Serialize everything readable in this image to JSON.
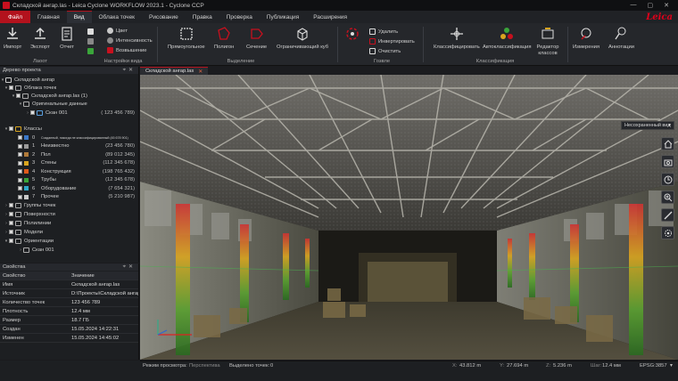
{
  "window": {
    "title": "Складской ангар.las - Leica Cyclone WORKFLOW 2023.1 - Cyclone CCP",
    "controls": [
      "—",
      "▢",
      "✕"
    ]
  },
  "menu": {
    "items": [
      "Файл",
      "Главная",
      "Вид",
      "Облака точек",
      "Рисование",
      "Правка",
      "Проверка",
      "Публикация",
      "Расширения"
    ],
    "active": "Вид"
  },
  "brand": "Leica",
  "ribbon": {
    "import": "Импорт",
    "export": "Экспорт",
    "report": "Отчет",
    "color": "Цвет",
    "intensity": "Интенсивность",
    "elevation": "Возвышение",
    "group_file": "Лаоот",
    "group_view": "Настройки вида",
    "rect": "Прямоугольное",
    "polygon": "Полигон",
    "section": "Сечение",
    "bbox": "Ограничивающий куб",
    "group_select": "Выделение",
    "delete": "Удалить",
    "invert": "Инвертировать",
    "clear": "Очистить",
    "group_fence": "Гозвле",
    "classify": "Классифицировать",
    "autoclass": "Автоклассификация",
    "classeditor": "Редактор классов",
    "group_class": "Классификация",
    "measure": "Измерения",
    "annotations": "Аннотации"
  },
  "project": {
    "header": "Дерево проекта",
    "root": "Складской ангар",
    "clouds": "Облака точек",
    "cloud_file": "Складской ангар.las (1)",
    "original": "Оригинальные данные",
    "scan": "Скан 001",
    "scan_count": "( 123 456 789)",
    "classes_label": "Классы",
    "classes": [
      {
        "num": "0",
        "name": "Созданный, никогда не классифицированный (45 678 901)",
        "count": "",
        "color": "#3c78c8"
      },
      {
        "num": "1",
        "name": "Неизвестно",
        "count": "(23 456 780)",
        "color": "#9a9a9a"
      },
      {
        "num": "2",
        "name": "Пол",
        "count": "(89 012 345)",
        "color": "#b07a3a"
      },
      {
        "num": "3",
        "name": "Стены",
        "count": "(112 345 678)",
        "color": "#d9a520"
      },
      {
        "num": "4",
        "name": "Конструкция",
        "count": "(198 765 432)",
        "color": "#e05a1a"
      },
      {
        "num": "5",
        "name": "Трубы",
        "count": "(12 345 678)",
        "color": "#3aa53a"
      },
      {
        "num": "6",
        "name": "Оборудование",
        "count": "(7 654 321)",
        "color": "#2fa8c8"
      },
      {
        "num": "7",
        "name": "Прочее",
        "count": "(5 210 987)",
        "color": "#c8c8c8"
      }
    ],
    "groups": "Группы точек",
    "surfaces": "Поверхности",
    "polylines": "Полилинии",
    "models": "Модели",
    "orientations": "Ориентации",
    "orient_scan": "Скан 001"
  },
  "properties": {
    "header": "Свойства",
    "col_prop": "Свойство",
    "col_val": "Значение",
    "rows": [
      {
        "k": "Имя",
        "v": "Складской ангар.las"
      },
      {
        "k": "Источник",
        "v": "D:\\Проекты\\Складской ангар"
      },
      {
        "k": "Количество точек",
        "v": "123 456 789"
      },
      {
        "k": "Плотность",
        "v": "12.4 мм"
      },
      {
        "k": "Размер",
        "v": "18.7 ГБ"
      },
      {
        "k": "Создан",
        "v": "15.05.2024 14:22:31"
      },
      {
        "k": "Изменен",
        "v": "15.05.2024 14:45:02"
      }
    ]
  },
  "tab": {
    "label": "Складской ангар.las",
    "close": "✕"
  },
  "view_dropdown": "Несохраненный вид",
  "status": {
    "mode_label": "Режим просмотра:",
    "mode_value": "Перспектива",
    "selected_label": "Выделено точек:",
    "selected_value": "0",
    "x_label": "X:",
    "x_value": "43.812 m",
    "y_label": "Y:",
    "y_value": "27.694 m",
    "z_label": "Z:",
    "z_value": "5.236 m",
    "step_label": "Шаг:",
    "step_value": "12.4 мм",
    "epsg": "EPSG:3857"
  },
  "colors": {
    "accent": "#b3121d",
    "panel": "#1d1f22",
    "ribbon": "#25272b"
  }
}
